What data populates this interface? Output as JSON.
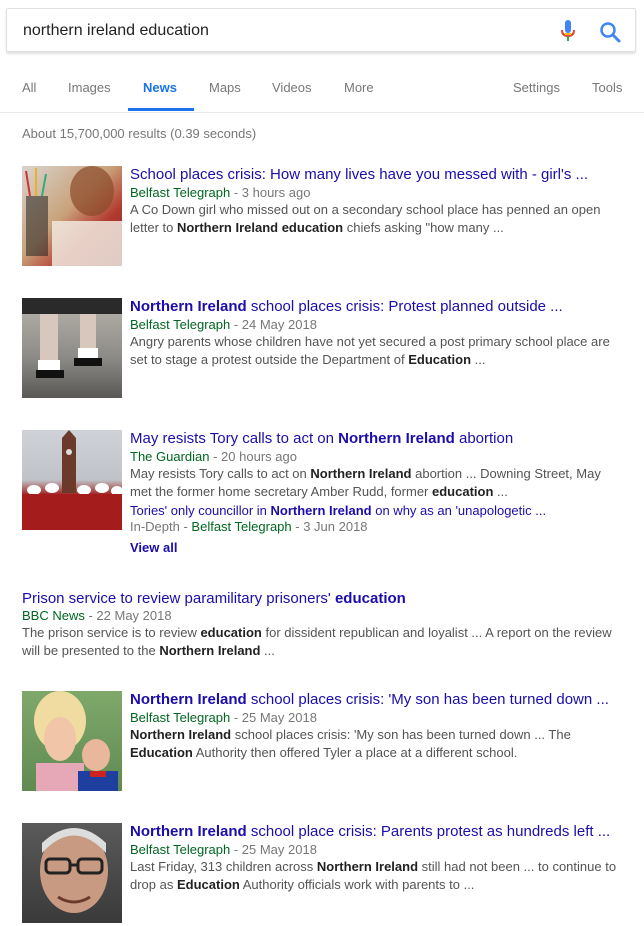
{
  "search": {
    "query": "northern ireland education"
  },
  "tabs": [
    {
      "label": "All"
    },
    {
      "label": "Images"
    },
    {
      "label": "News"
    },
    {
      "label": "Maps"
    },
    {
      "label": "Videos"
    },
    {
      "label": "More"
    },
    {
      "label": "Settings"
    },
    {
      "label": "Tools"
    }
  ],
  "stats": "About 15,700,000 results (0.39 seconds)",
  "results": [
    {
      "title_parts": [
        "School places crisis: How many lives have you messed with - girl's ..."
      ],
      "publisher": "Belfast Telegraph",
      "time": " - 3 hours ago",
      "snippet_parts": [
        "A Co Down girl who missed out on a secondary school place has penned an open letter to ",
        "Northern Ireland education",
        " chiefs asking \"how many ..."
      ]
    },
    {
      "title_parts": [
        "Northern Ireland",
        " school places crisis: Protest planned outside ..."
      ],
      "publisher": "Belfast Telegraph",
      "time": " - 24 May 2018",
      "snippet_parts": [
        "Angry parents whose children have not yet secured a post primary school place are set to stage a protest outside the Department of ",
        "Education",
        " ..."
      ]
    },
    {
      "title_parts": [
        "May resists Tory calls to act on ",
        "Northern Ireland",
        " abortion"
      ],
      "publisher": "The Guardian",
      "time": " - 20 hours ago",
      "snippet_parts": [
        "May resists Tory calls to act on ",
        "Northern Ireland",
        " abortion ... Downing Street, May met the former home secretary Amber Rudd, former ",
        "education",
        " ..."
      ],
      "sub_title_parts": [
        "Tories' only councillor in ",
        "Northern Ireland",
        " on why as an 'unapologetic ..."
      ],
      "sub_prefix": "In-Depth - ",
      "sub_publisher": "Belfast Telegraph",
      "sub_time": " - 3 Jun 2018",
      "view_all": "View all"
    },
    {
      "title_parts": [
        "Prison service to review paramilitary prisoners' ",
        "education"
      ],
      "publisher": "BBC News",
      "time": " - 22 May 2018",
      "snippet_parts": [
        "The prison service is to review ",
        "education",
        " for dissident republican and loyalist ... A report on the review will be presented to the ",
        "Northern Ireland",
        " ..."
      ]
    },
    {
      "title_parts": [
        "Northern Ireland",
        " school places crisis: 'My son has been turned down ..."
      ],
      "publisher": "Belfast Telegraph",
      "time": " - 25 May 2018",
      "snippet_parts": [
        "Northern Ireland",
        " school places crisis: 'My son has been turned down ... The ",
        "Education",
        " Authority then offered Tyler a place at a different school."
      ]
    },
    {
      "title_parts": [
        "Northern Ireland",
        " school place crisis: Parents protest as hundreds left ..."
      ],
      "publisher": "Belfast Telegraph",
      "time": " - 25 May 2018",
      "snippet_parts": [
        "Last Friday, 313 children across ",
        "Northern Ireland",
        " still had not been ... to continue to drop as ",
        "Education",
        " Authority officials work with parents to ..."
      ]
    }
  ]
}
